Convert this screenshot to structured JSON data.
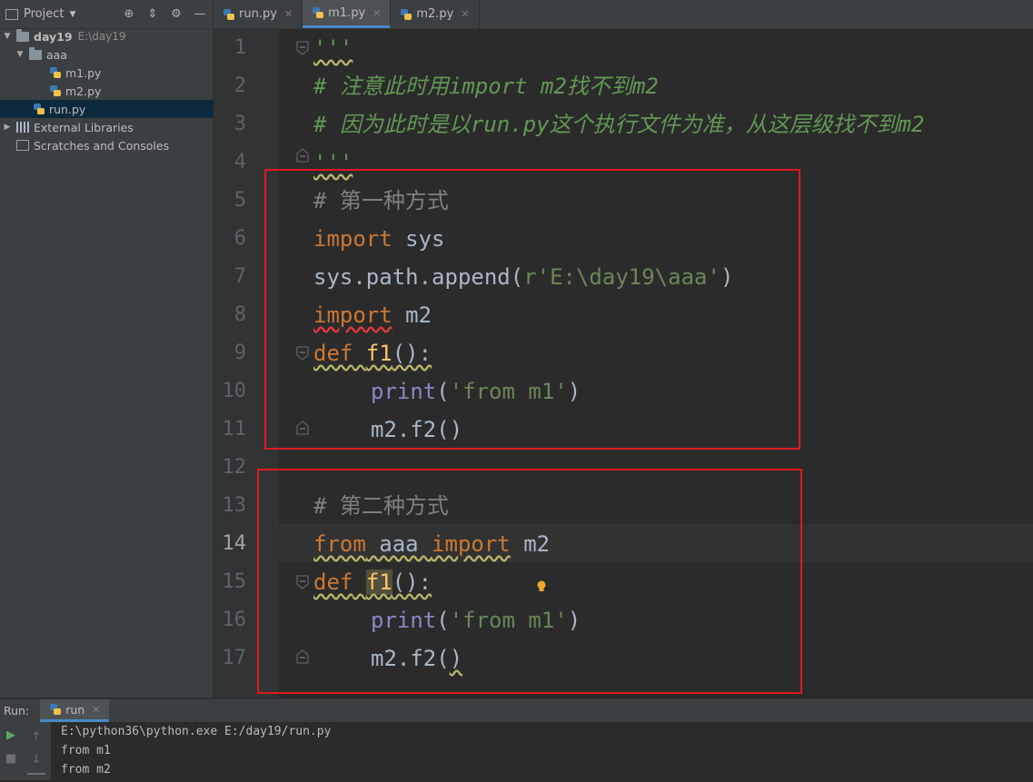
{
  "project_panel": {
    "title": "Project",
    "tree": [
      {
        "label": "day19",
        "hint": "E:\\day19"
      },
      {
        "label": "aaa"
      },
      {
        "label": "m1.py"
      },
      {
        "label": "m2.py"
      },
      {
        "label": "run.py"
      },
      {
        "label": "External Libraries"
      },
      {
        "label": "Scratches and Consoles"
      }
    ]
  },
  "tabs": [
    {
      "label": "run.py",
      "active": false
    },
    {
      "label": "m1.py",
      "active": true
    },
    {
      "label": "m2.py",
      "active": false
    }
  ],
  "editor": {
    "current_line": 14,
    "line_numbers": [
      "1",
      "2",
      "3",
      "4",
      "5",
      "6",
      "7",
      "8",
      "9",
      "10",
      "11",
      "12",
      "13",
      "14",
      "15",
      "16",
      "17"
    ],
    "lines": {
      "l1": "'''",
      "l2": "# 注意此时用import m2找不到m2",
      "l3": "# 因为此时是以run.py这个执行文件为准，从这层级找不到m2",
      "l4": "'''",
      "l5": "# 第一种方式",
      "l6_kw": "import",
      "l6_rest": " sys",
      "l7_a": "sys.path.append(",
      "l7_str": "r'E:\\day19\\aaa'",
      "l7_b": ")",
      "l8_kw": "import",
      "l8_rest": " m2",
      "l9_kw": "def",
      "l9_fn": "f1",
      "l9_rest": "():",
      "l10_bi": "print",
      "l10_a": "(",
      "l10_str": "'from m1'",
      "l10_b": ")",
      "l11": "m2.f2()",
      "l13": "# 第二种方式",
      "l14_kw1": "from",
      "l14_mid": " aaa ",
      "l14_kw2": "import",
      "l14_rest": " m2",
      "l15_kw": "def",
      "l15_fn": "f1",
      "l15_rest": "():",
      "l16_bi": "print",
      "l16_a": "(",
      "l16_str": "'from m1'",
      "l16_b": ")",
      "l17_a": "m2.f2(",
      "l17_b": ")"
    }
  },
  "run_panel": {
    "label": "Run:",
    "tab": "run",
    "output": [
      "E:\\python36\\python.exe E:/day19/run.py",
      "from m1",
      "from m2"
    ]
  },
  "colors": {
    "highlight_box": "#e0191f",
    "keyword": "#cc7832",
    "string": "#6a8759",
    "comment": "#629755"
  },
  "icons": [
    "project-icon",
    "target-icon",
    "collapse-icon",
    "gear-icon",
    "minimize-icon",
    "folder-icon",
    "python-file-icon",
    "libraries-icon",
    "scratches-icon",
    "fold-marker-icon",
    "bulb-icon",
    "run-icon",
    "stop-icon",
    "up-arrow-icon",
    "down-arrow-icon"
  ]
}
